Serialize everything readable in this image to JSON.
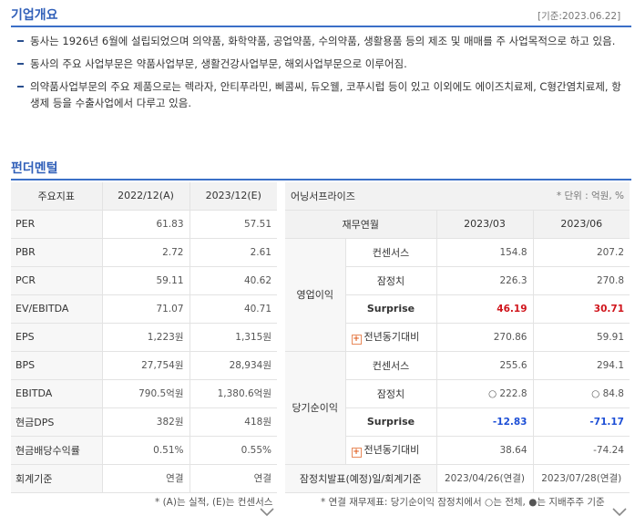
{
  "overview": {
    "title": "기업개요",
    "ref_date": "[기준:2023.06.22]",
    "items": [
      "동사는 1926년 6월에 설립되었으며 의약품, 화학약품, 공업약품, 수의약품, 생활용품 등의 제조 및 매매를 주 사업목적으로 하고 있음.",
      "동사의 주요 사업부문은 약품사업부문, 생활건강사업부문, 해외사업부문으로 이루어짐.",
      "의약품사업부문의 주요 제품으로는 렉라자, 안티푸라민, 삐콤씨, 듀오웰, 코푸시럽 등이 있고 이외에도 에이즈치료제, C형간염치료제, 항생제 등을 수출사업에서 다루고 있음."
    ]
  },
  "fundamental": {
    "title": "펀더멘털",
    "headers": [
      "주요지표",
      "2022/12(A)",
      "2023/12(E)"
    ],
    "rows": [
      {
        "label": "PER",
        "a": "61.83",
        "e": "57.51"
      },
      {
        "label": "PBR",
        "a": "2.72",
        "e": "2.61"
      },
      {
        "label": "PCR",
        "a": "59.11",
        "e": "40.62"
      },
      {
        "label": "EV/EBITDA",
        "a": "71.07",
        "e": "40.71"
      },
      {
        "label": "EPS",
        "a": "1,223원",
        "e": "1,315원"
      },
      {
        "label": "BPS",
        "a": "27,754원",
        "e": "28,934원"
      },
      {
        "label": "EBITDA",
        "a": "790.5억원",
        "e": "1,380.6억원"
      },
      {
        "label": "현금DPS",
        "a": "382원",
        "e": "418원"
      },
      {
        "label": "현금배당수익률",
        "a": "0.51%",
        "e": "0.55%"
      },
      {
        "label": "회계기준",
        "a": "연결",
        "e": "연결"
      }
    ],
    "note": "* (A)는 실적, (E)는 컨센서스"
  },
  "earnings": {
    "title": "어닝서프라이즈",
    "unit": "* 단위 : 억원, %",
    "headers": [
      "재무연월",
      "2023/03",
      "2023/06"
    ],
    "groups": [
      {
        "name": "영업이익",
        "rows": [
          {
            "label": "컨센서스",
            "q1": "154.8",
            "q2": "207.2"
          },
          {
            "label": "잠정치",
            "q1": "226.3",
            "q2": "270.8"
          },
          {
            "label": "Surprise",
            "q1": "46.19",
            "q2": "30.71"
          },
          {
            "label": "전년동기대비",
            "q1": "270.86",
            "q2": "59.91"
          }
        ]
      },
      {
        "name": "당기순이익",
        "rows": [
          {
            "label": "컨센서스",
            "q1": "255.6",
            "q2": "294.1"
          },
          {
            "label": "잠정치",
            "q1": "○ 222.8",
            "q2": "○ 84.8"
          },
          {
            "label": "Surprise",
            "q1": "-12.83",
            "q2": "-71.17"
          },
          {
            "label": "전년동기대비",
            "q1": "38.64",
            "q2": "-74.24"
          }
        ]
      }
    ],
    "footer": {
      "label": "잠정치발표(예정)일/회계기준",
      "q1": "2023/04/26(연결)",
      "q2": "2023/07/28(연결)"
    },
    "note": "* 연결 재무제표: 당기순이익 잠정치에서 ○는 전체, ●는 지배주주 기준",
    "plus_glyph": "+"
  },
  "colors": {
    "accent": "#3160b9",
    "positive": "#d0141b",
    "negative": "#1d4fd6"
  }
}
